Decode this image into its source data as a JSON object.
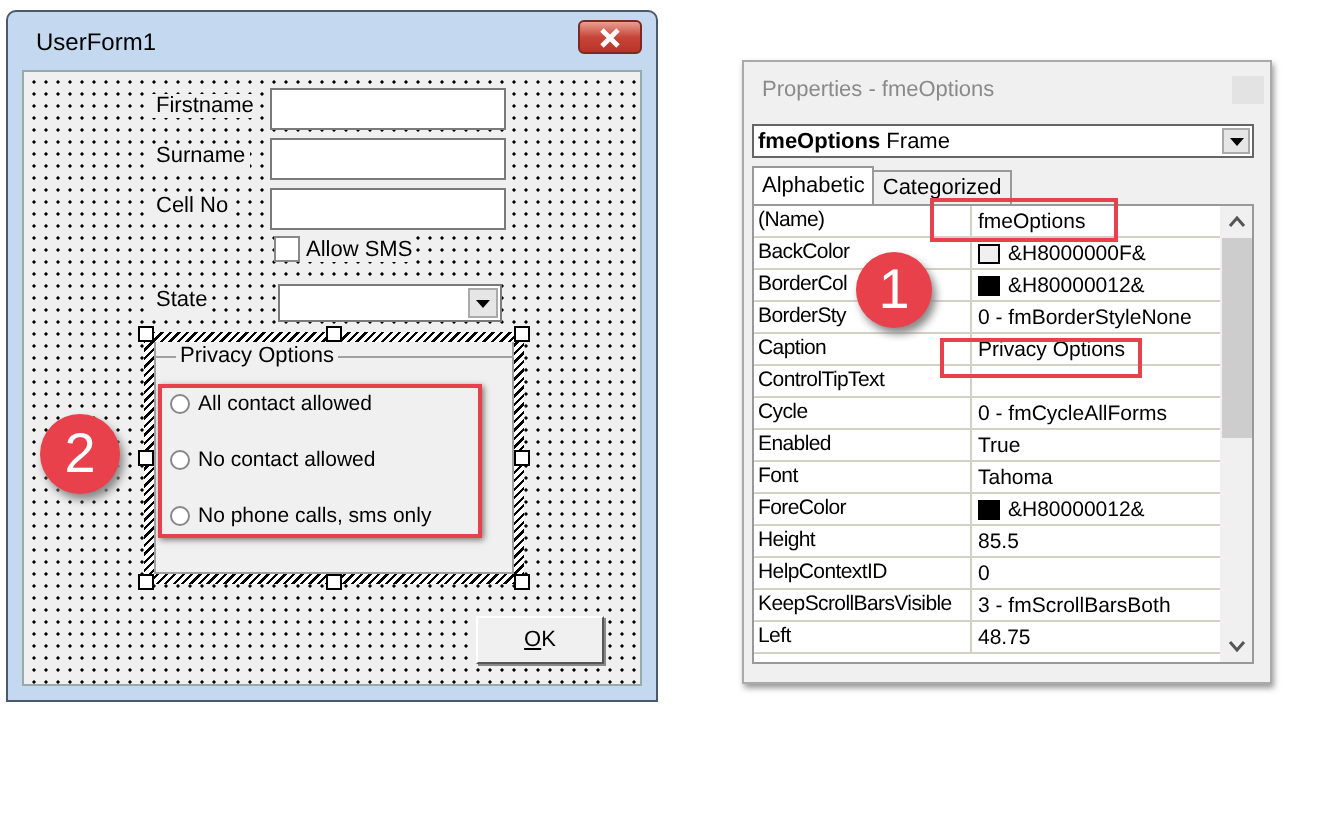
{
  "userform": {
    "title": "UserForm1",
    "fields": [
      {
        "label": "Firstname"
      },
      {
        "label": "Surname"
      },
      {
        "label": "Cell No"
      }
    ],
    "checkbox": {
      "label": "Allow SMS",
      "checked": false
    },
    "combo": {
      "label": "State"
    },
    "frame": {
      "caption": "Privacy Options",
      "selected": true,
      "options": [
        {
          "label": "All contact allowed",
          "selected": false
        },
        {
          "label": "No contact allowed",
          "selected": false
        },
        {
          "label": "No phone calls, sms only",
          "selected": false
        }
      ]
    },
    "ok_button": "OK"
  },
  "properties": {
    "title": "Properties - fmeOptions",
    "object": {
      "name": "fmeOptions",
      "type": "Frame"
    },
    "tabs": [
      {
        "label": "Alphabetic",
        "selected": true
      },
      {
        "label": "Categorized",
        "selected": false
      }
    ],
    "rows": [
      {
        "name": "(Name)",
        "value": "fmeOptions"
      },
      {
        "name": "BackColor",
        "value": "&H8000000F&",
        "color": "#f0f0f0"
      },
      {
        "name": "BorderCol",
        "value": "&H80000012&",
        "color": "#000000"
      },
      {
        "name": "BorderSty",
        "value": "0 - fmBorderStyleNone"
      },
      {
        "name": "Caption",
        "value": "Privacy Options"
      },
      {
        "name": "ControlTipText"
      },
      {
        "name": "Cycle",
        "value": "0 - fmCycleAllForms"
      },
      {
        "name": "Enabled",
        "value": "True"
      },
      {
        "name": "Font",
        "value": "Tahoma"
      },
      {
        "name": "ForeColor",
        "value": "&H80000012&",
        "color": "#000000"
      },
      {
        "name": "Height",
        "value": "85.5"
      },
      {
        "name": "HelpContextID",
        "value": "0"
      },
      {
        "name": "KeepScrollBarsVisible",
        "value": "3 - fmScrollBarsBoth"
      },
      {
        "name": "Left",
        "value": "48.75"
      }
    ]
  },
  "callouts": [
    {
      "label": "1"
    },
    {
      "label": "2"
    }
  ]
}
